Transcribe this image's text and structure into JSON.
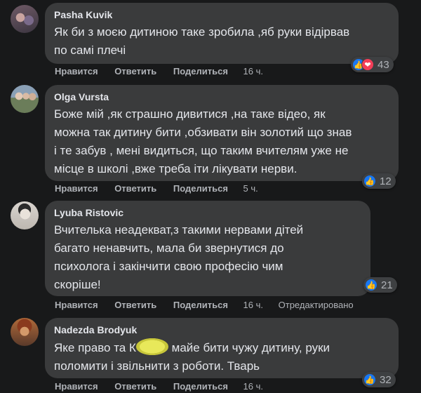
{
  "actions": {
    "like": "Нравится",
    "reply": "Ответить",
    "share": "Поделиться"
  },
  "comments": [
    {
      "author": "Pasha Kuvik",
      "lines": [
        "Як би з моєю дитиною таке зробила ,яб руки відірвав",
        "по самі плечі"
      ],
      "time": "16 ч.",
      "reactions": "43",
      "reaction_icons": [
        "like-icon",
        "love-icon"
      ]
    },
    {
      "author": "Olga Vursta",
      "lines": [
        "Боже мій ,як страшно дивитися ,на таке відео, як",
        "можна так дитину бити ,обзивати він золотий що знав",
        "і те забув , мені видиться, що таким вчителям уже не",
        "місце в школі ,вже треба іти лікувати нерви."
      ],
      "time": "5 ч.",
      "reactions": "12",
      "reaction_icons": [
        "like-icon"
      ]
    },
    {
      "author": "Lyuba Ristovic",
      "lines": [
        "Вчителька неадекват,з такими нервами дітей",
        "багато ненавчить, мала би звернутися до",
        "психолога і закінчити свою професію чим",
        "скоріше!"
      ],
      "time": "16 ч.",
      "edited": "Отредактировано",
      "reactions": "21",
      "reaction_icons": [
        "like-icon"
      ]
    },
    {
      "author": "Nadezda Brodyuk",
      "line1_before": "Яке право та К",
      "line1_after": " майе бити чужу дитину, руки",
      "line2": "поломити і звільнити з роботи. Тварь",
      "time": "16 ч.",
      "reactions": "32",
      "reaction_icons": [
        "like-icon"
      ]
    }
  ],
  "colors": {
    "background": "#18191a",
    "bubble": "#3a3b3c",
    "text": "#e4e6eb",
    "secondary_text": "#b0b3b8",
    "like_blue": "#1877f2",
    "love_red": "#f33e58",
    "redaction": "#e8e85a"
  }
}
